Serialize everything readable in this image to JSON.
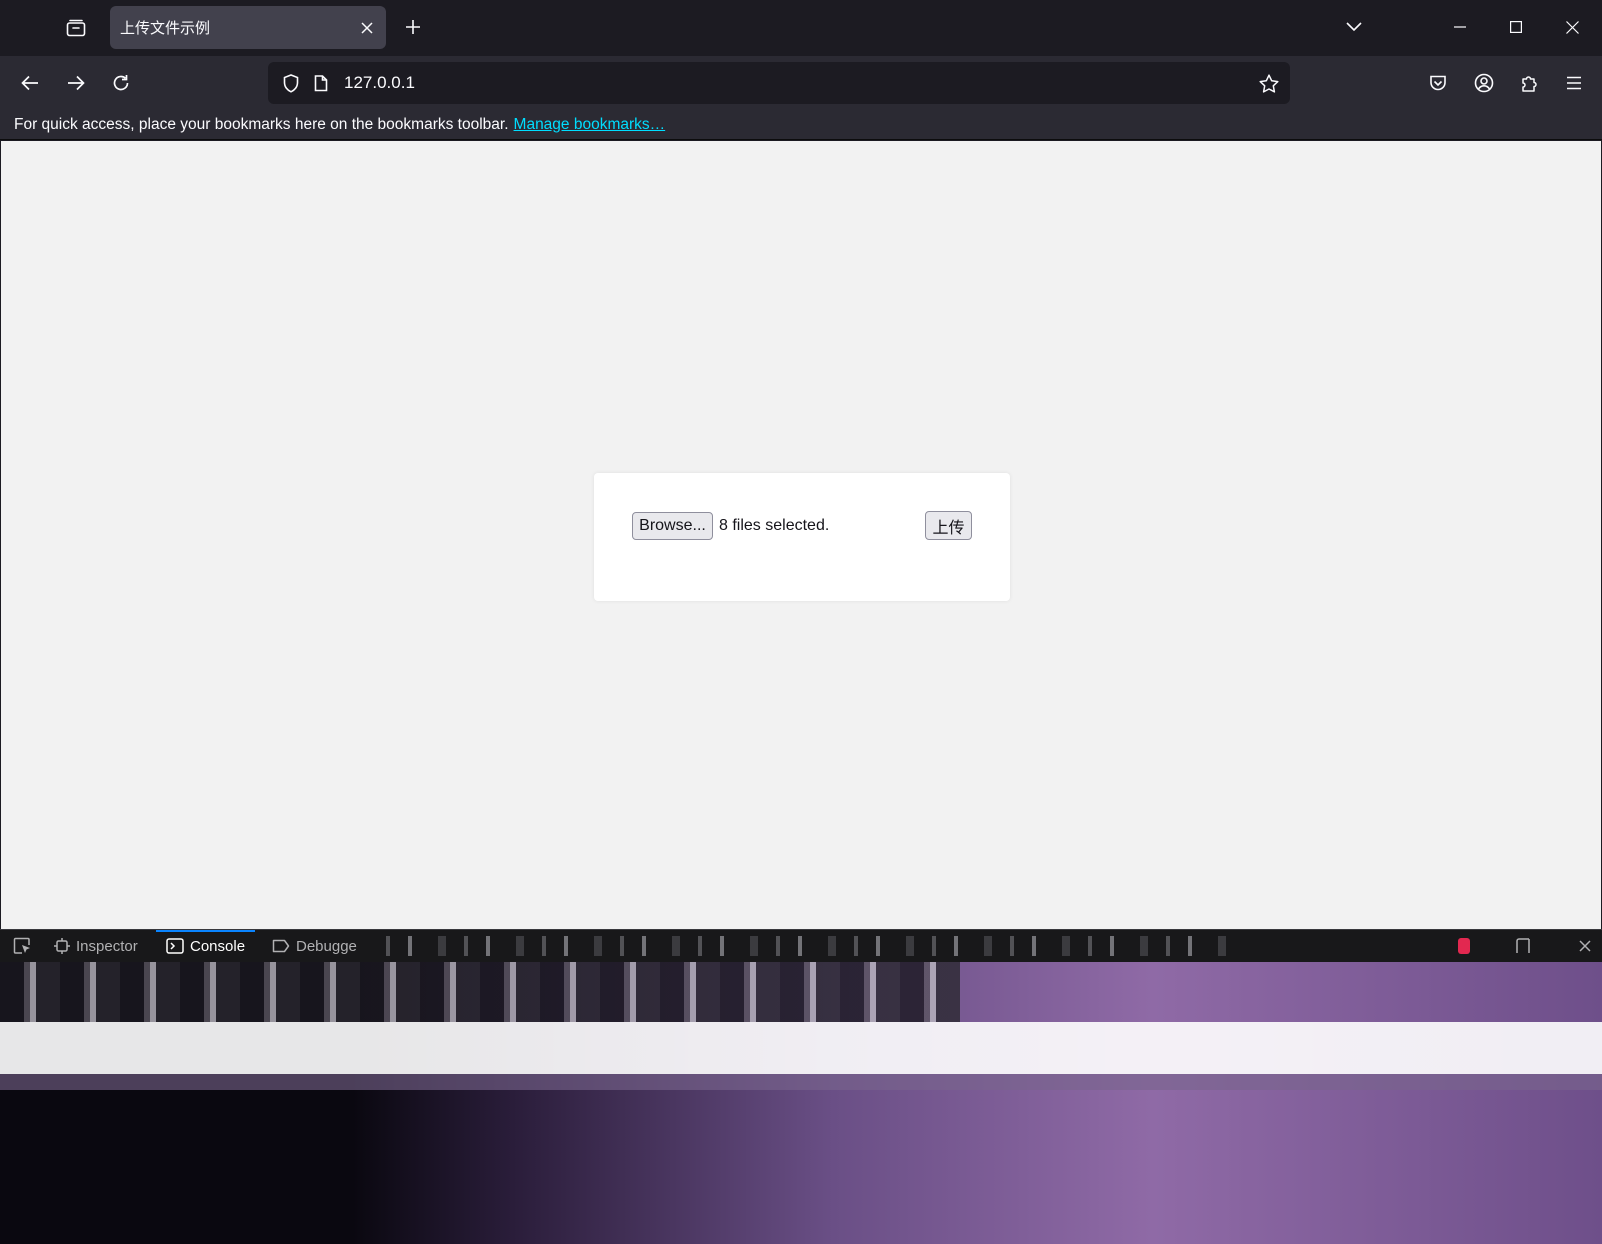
{
  "tab": {
    "title": "上传文件示例"
  },
  "address": {
    "url": "127.0.0.1"
  },
  "bookmarks_bar": {
    "message": "For quick access, place your bookmarks here on the bookmarks toolbar.",
    "link": "Manage bookmarks…"
  },
  "upload_form": {
    "browse_label": "Browse...",
    "file_status": "8 files selected.",
    "submit_label": "上传"
  },
  "devtools": {
    "tabs": [
      {
        "label": "Inspector",
        "icon": "inspector-icon"
      },
      {
        "label": "Console",
        "icon": "console-icon",
        "selected": true
      },
      {
        "label": "Debugge",
        "icon": "debugger-icon"
      }
    ]
  },
  "colors": {
    "accent": "#0a84ff",
    "link": "#00ddff",
    "page_bg": "#f2f2f2"
  }
}
